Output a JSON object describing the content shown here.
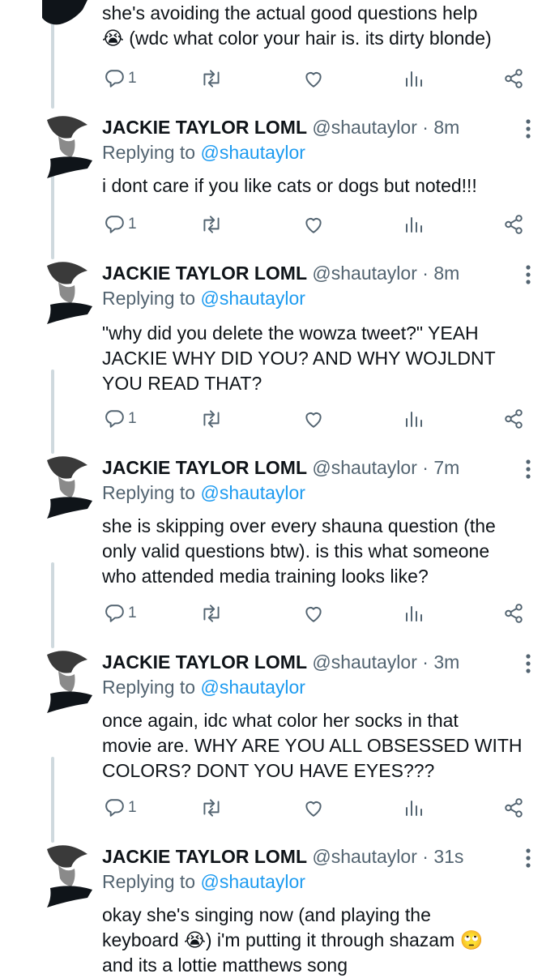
{
  "colors": {
    "text": "#0f1419",
    "muted": "#536471",
    "link": "#1d9bf0",
    "thread_line": "#cfd9de"
  },
  "icons": {
    "reply": "reply-icon",
    "retweet": "retweet-icon",
    "like": "heart-icon",
    "views": "analytics-icon",
    "share": "share-icon",
    "more": "more-options-icon",
    "avatar": "avatar-icon"
  },
  "top_tweet": {
    "lines": [
      "she's avoiding the actual good questions help",
      "😭 (wdc what color your hair is. its dirty blonde)"
    ],
    "reply_count": "1"
  },
  "tweets": [
    {
      "name": "JACKIE TAYLOR LOML",
      "handle": "@shautaylor",
      "dot": "·",
      "time": "8m",
      "replying_prefix": "Replying to",
      "replying_to": "@shautaylor",
      "lines": [
        "i dont care if you like cats or dogs but noted!!!"
      ],
      "reply_count": "1"
    },
    {
      "name": "JACKIE TAYLOR LOML",
      "handle": "@shautaylor",
      "dot": "·",
      "time": "8m",
      "replying_prefix": "Replying to",
      "replying_to": "@shautaylor",
      "lines": [
        "\"why did you delete the wowza tweet?\" YEAH",
        "JACKIE WHY DID YOU? AND WHY WOJLDNT",
        "YOU READ THAT?"
      ],
      "reply_count": "1"
    },
    {
      "name": "JACKIE TAYLOR LOML",
      "handle": "@shautaylor",
      "dot": "·",
      "time": "7m",
      "replying_prefix": "Replying to",
      "replying_to": "@shautaylor",
      "lines": [
        "she is skipping over every shauna question (the",
        "only valid questions btw). is this what someone",
        "who attended media training looks like?"
      ],
      "reply_count": "1"
    },
    {
      "name": "JACKIE TAYLOR LOML",
      "handle": "@shautaylor",
      "dot": "·",
      "time": "3m",
      "replying_prefix": "Replying to",
      "replying_to": "@shautaylor",
      "lines": [
        "once again, idc what color her socks in that",
        "movie are. WHY ARE YOU ALL OBSESSED WITH",
        "COLORS? DONT YOU HAVE EYES???"
      ],
      "reply_count": "1"
    },
    {
      "name": "JACKIE TAYLOR LOML",
      "handle": "@shautaylor",
      "dot": "·",
      "time": "31s",
      "replying_prefix": "Replying to",
      "replying_to": "@shautaylor",
      "lines": [
        "okay she's singing now (and playing the",
        "keyboard 😭) i'm putting it through shazam 🙄",
        "and its a lottie matthews song"
      ],
      "reply_count": ""
    }
  ]
}
